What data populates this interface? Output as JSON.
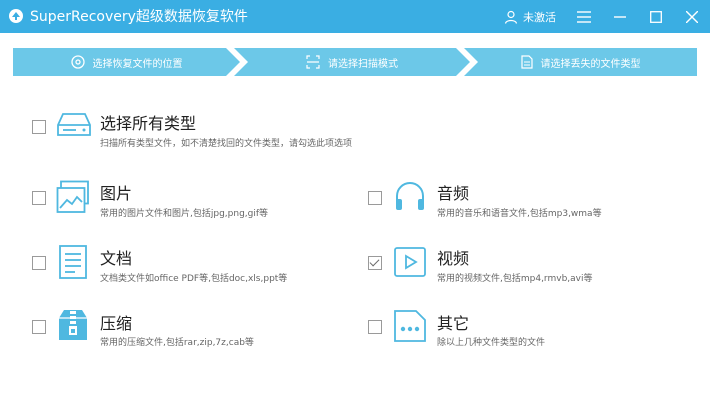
{
  "app": {
    "title": "SuperRecovery超级数据恢复软件"
  },
  "header": {
    "user_label": "未激活"
  },
  "steps": [
    {
      "label": "选择恢复文件的位置"
    },
    {
      "label": "请选择扫描模式"
    },
    {
      "label": "请选择丢失的文件类型"
    }
  ],
  "all_types": {
    "title": "选择所有类型",
    "desc": "扫描所有类型文件，如不清楚找回的文件类型，请勾选此项选项",
    "checked": false
  },
  "types": {
    "image": {
      "title": "图片",
      "desc": "常用的图片文件和图片,包括jpg,png,gif等",
      "checked": false
    },
    "audio": {
      "title": "音频",
      "desc": "常用的音乐和语音文件,包括mp3,wma等",
      "checked": false
    },
    "doc": {
      "title": "文档",
      "desc": "文档类文件如office PDF等,包括doc,xls,ppt等",
      "checked": false
    },
    "video": {
      "title": "视频",
      "desc": "常用的视频文件,包括mp4,rmvb,avi等",
      "checked": true
    },
    "archive": {
      "title": "压缩",
      "desc": "常用的压缩文件,包括rar,zip,7z,cab等",
      "checked": false
    },
    "other": {
      "title": "其它",
      "desc": "除以上几种文件类型的文件",
      "checked": false
    }
  },
  "colors": {
    "titlebar": "#3aaee3",
    "steps": "#6cc8e8",
    "icon": "#4fb8e0"
  }
}
